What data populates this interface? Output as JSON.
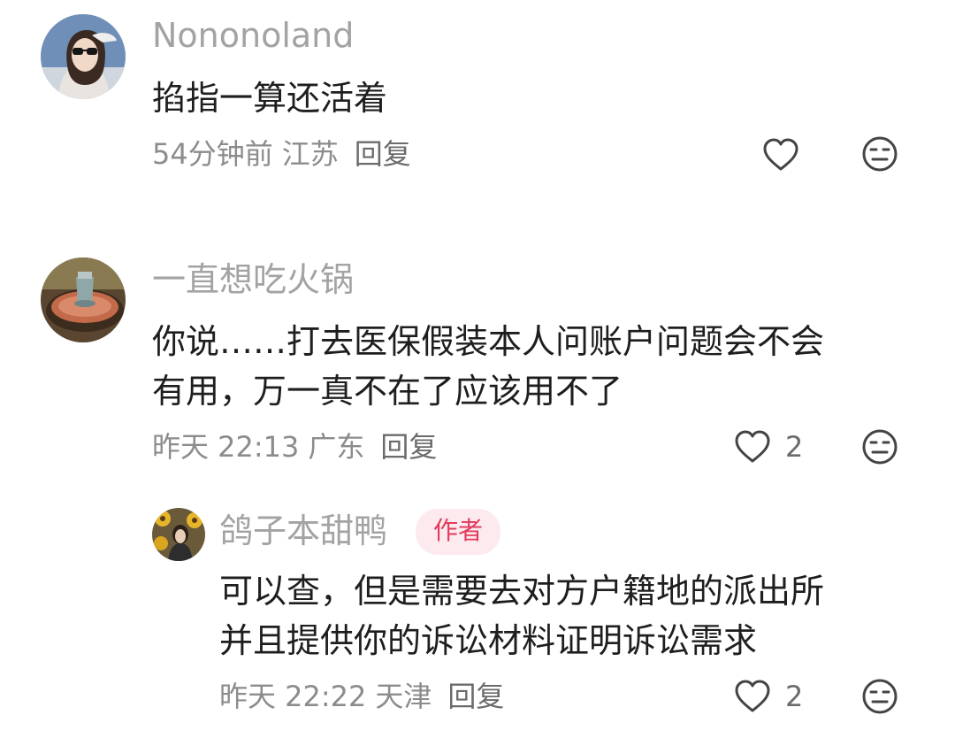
{
  "comments": [
    {
      "username": "Nononoland",
      "lines": [
        "掐指一算还活着"
      ],
      "time": "54分钟前",
      "location": "江苏",
      "reply_label": "回复",
      "like_count": ""
    },
    {
      "username": "一直想吃火锅",
      "lines": [
        "你说……打去医保假装本人问账户问题会不会",
        "有用，万一真不在了应该用不了"
      ],
      "time": "昨天 22:13",
      "location": "广东",
      "reply_label": "回复",
      "like_count": "2"
    }
  ],
  "reply": {
    "username": "鸽子本甜鸭",
    "badge": "作者",
    "lines": [
      "可以查，但是需要去对方户籍地的派出所",
      "并且提供你的诉讼材料证明诉讼需求"
    ],
    "time": "昨天 22:22",
    "location": "天津",
    "reply_label": "回复",
    "like_count": "2"
  },
  "icons": {
    "like": "heart-outline-icon",
    "dislike": "meh-face-icon"
  },
  "colors": {
    "badge_text": "#e23a5c",
    "badge_bg": "#fdeaef",
    "username": "#a3a3a3",
    "meta": "#8c8c8c"
  }
}
